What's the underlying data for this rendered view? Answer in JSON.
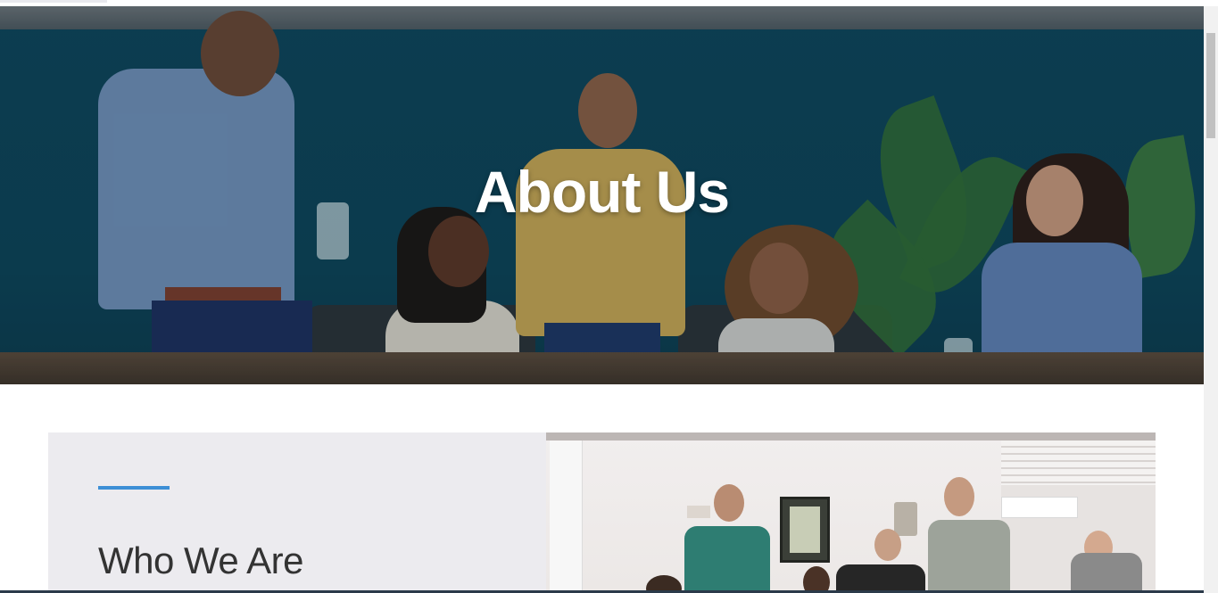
{
  "hero": {
    "title": "About Us"
  },
  "who_we_are": {
    "heading": "Who We Are",
    "accent_color": "#3d8fd6",
    "panel_color": "#ecebef"
  },
  "colors": {
    "hero_wall": "#0d4559",
    "heading_text": "#333333"
  }
}
